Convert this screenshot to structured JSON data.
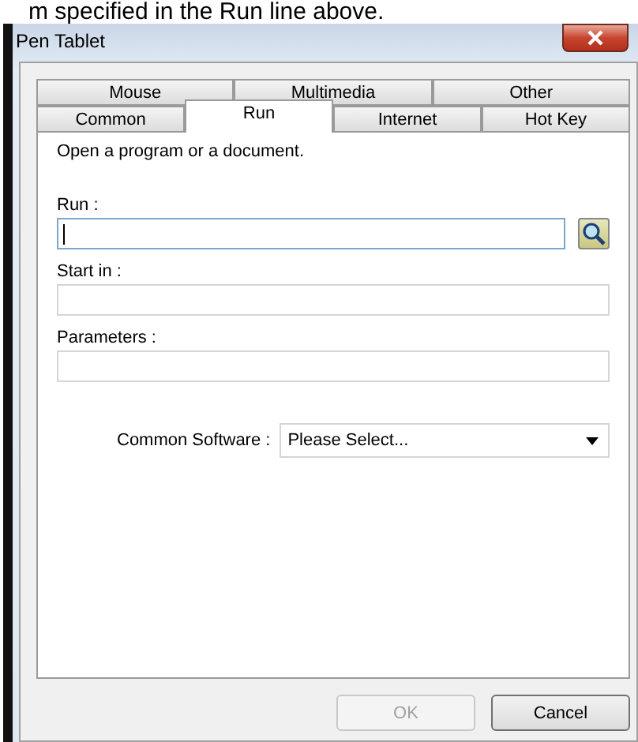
{
  "caption": "m specified in the Run line above.",
  "window": {
    "title": "Pen Tablet"
  },
  "tab_rows": [
    [
      {
        "label": "Mouse",
        "selected": false
      },
      {
        "label": "Multimedia",
        "selected": false
      },
      {
        "label": "Other",
        "selected": false
      }
    ],
    [
      {
        "label": "Common",
        "selected": false
      },
      {
        "label": "Run",
        "selected": true
      },
      {
        "label": "Internet",
        "selected": false
      },
      {
        "label": "Hot Key",
        "selected": false
      }
    ]
  ],
  "description": "Open a program or a document.",
  "fields": [
    {
      "label": "Run :",
      "focused": true,
      "browse": true
    },
    {
      "label": "Start in :",
      "focused": false,
      "browse": false
    },
    {
      "label": "Parameters :",
      "focused": false,
      "browse": false
    }
  ],
  "common_software": {
    "label": "Common Software :",
    "value": "Please Select..."
  },
  "buttons": [
    {
      "label": "OK",
      "disabled": true
    },
    {
      "label": "Cancel",
      "disabled": false
    }
  ]
}
